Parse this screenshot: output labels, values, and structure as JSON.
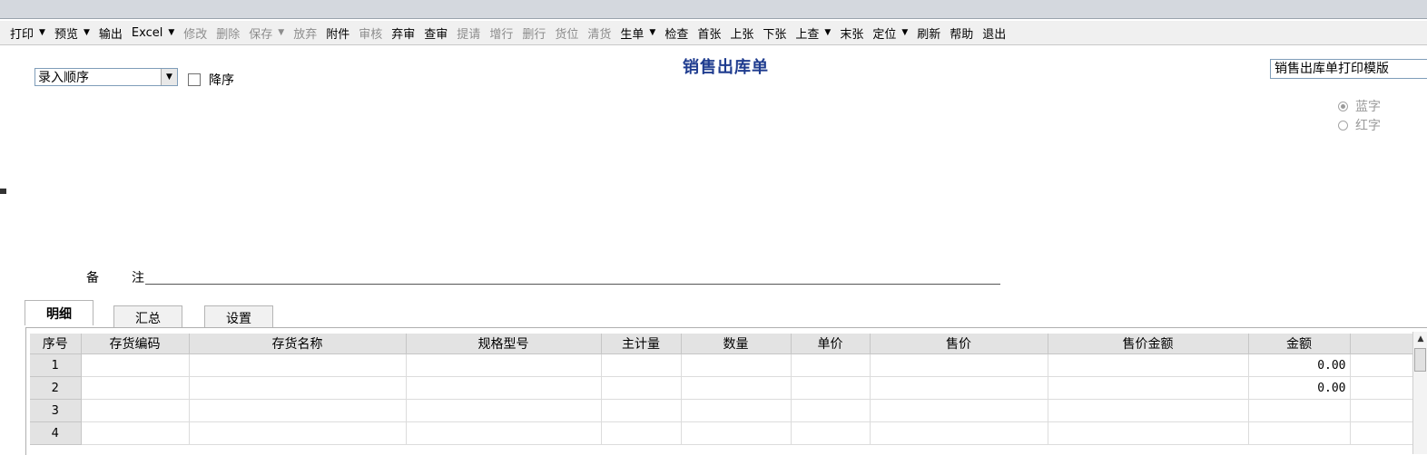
{
  "toolbar": {
    "items": [
      {
        "label": "打印",
        "dropdown": true,
        "disabled": false
      },
      {
        "label": "预览",
        "dropdown": true,
        "disabled": false
      },
      {
        "label": "输出",
        "dropdown": false,
        "disabled": false
      },
      {
        "label": "Excel",
        "dropdown": true,
        "disabled": false
      },
      {
        "label": "修改",
        "dropdown": false,
        "disabled": true
      },
      {
        "label": "删除",
        "dropdown": false,
        "disabled": true
      },
      {
        "label": "保存",
        "dropdown": true,
        "disabled": true
      },
      {
        "label": "放弃",
        "dropdown": false,
        "disabled": true
      },
      {
        "label": "附件",
        "dropdown": false,
        "disabled": false
      },
      {
        "label": "审核",
        "dropdown": false,
        "disabled": true
      },
      {
        "label": "弃审",
        "dropdown": false,
        "disabled": false
      },
      {
        "label": "查审",
        "dropdown": false,
        "disabled": false
      },
      {
        "label": "提请",
        "dropdown": false,
        "disabled": true
      },
      {
        "label": "增行",
        "dropdown": false,
        "disabled": true
      },
      {
        "label": "删行",
        "dropdown": false,
        "disabled": true
      },
      {
        "label": "货位",
        "dropdown": false,
        "disabled": true
      },
      {
        "label": "清货",
        "dropdown": false,
        "disabled": true
      },
      {
        "label": "生单",
        "dropdown": true,
        "disabled": false
      },
      {
        "label": "检查",
        "dropdown": false,
        "disabled": false
      },
      {
        "label": "首张",
        "dropdown": false,
        "disabled": false
      },
      {
        "label": "上张",
        "dropdown": false,
        "disabled": false
      },
      {
        "label": "下张",
        "dropdown": false,
        "disabled": false
      },
      {
        "label": "上查",
        "dropdown": true,
        "disabled": false
      },
      {
        "label": "末张",
        "dropdown": false,
        "disabled": false
      },
      {
        "label": "定位",
        "dropdown": true,
        "disabled": false
      },
      {
        "label": "刷新",
        "dropdown": false,
        "disabled": false
      },
      {
        "label": "帮助",
        "dropdown": false,
        "disabled": false
      },
      {
        "label": "退出",
        "dropdown": false,
        "disabled": false
      }
    ]
  },
  "form": {
    "sort_order": "录入顺序",
    "descending_label": "降序",
    "descending_checked": false,
    "title": "销售出库单",
    "print_template": "销售出库单打印模版",
    "color_options": [
      {
        "label": "蓝字",
        "selected": true
      },
      {
        "label": "红字",
        "selected": false
      }
    ],
    "remark_label_1": "备",
    "remark_label_2": "注",
    "remark_value": ""
  },
  "tabs": [
    {
      "label": "明细",
      "active": true
    },
    {
      "label": "汇总",
      "active": false
    },
    {
      "label": "设置",
      "active": false
    }
  ],
  "grid": {
    "columns": [
      "序号",
      "存货编码",
      "存货名称",
      "规格型号",
      "主计量",
      "数量",
      "单价",
      "售价",
      "售价金额",
      "金额",
      ""
    ],
    "rows": [
      [
        "1",
        "",
        "",
        "",
        "",
        "",
        "",
        "",
        "",
        "0.00",
        ""
      ],
      [
        "2",
        "",
        "",
        "",
        "",
        "",
        "",
        "",
        "",
        "0.00",
        ""
      ],
      [
        "3",
        "",
        "",
        "",
        "",
        "",
        "",
        "",
        "",
        "",
        ""
      ],
      [
        "4",
        "",
        "",
        "",
        "",
        "",
        "",
        "",
        "",
        "",
        ""
      ]
    ]
  },
  "colors": {
    "title": "#1f3c8f",
    "toolbar_bg": "#f0f0f0",
    "disabled_text": "#8d8d8d",
    "grid_header_bg": "#e3e3e3"
  }
}
